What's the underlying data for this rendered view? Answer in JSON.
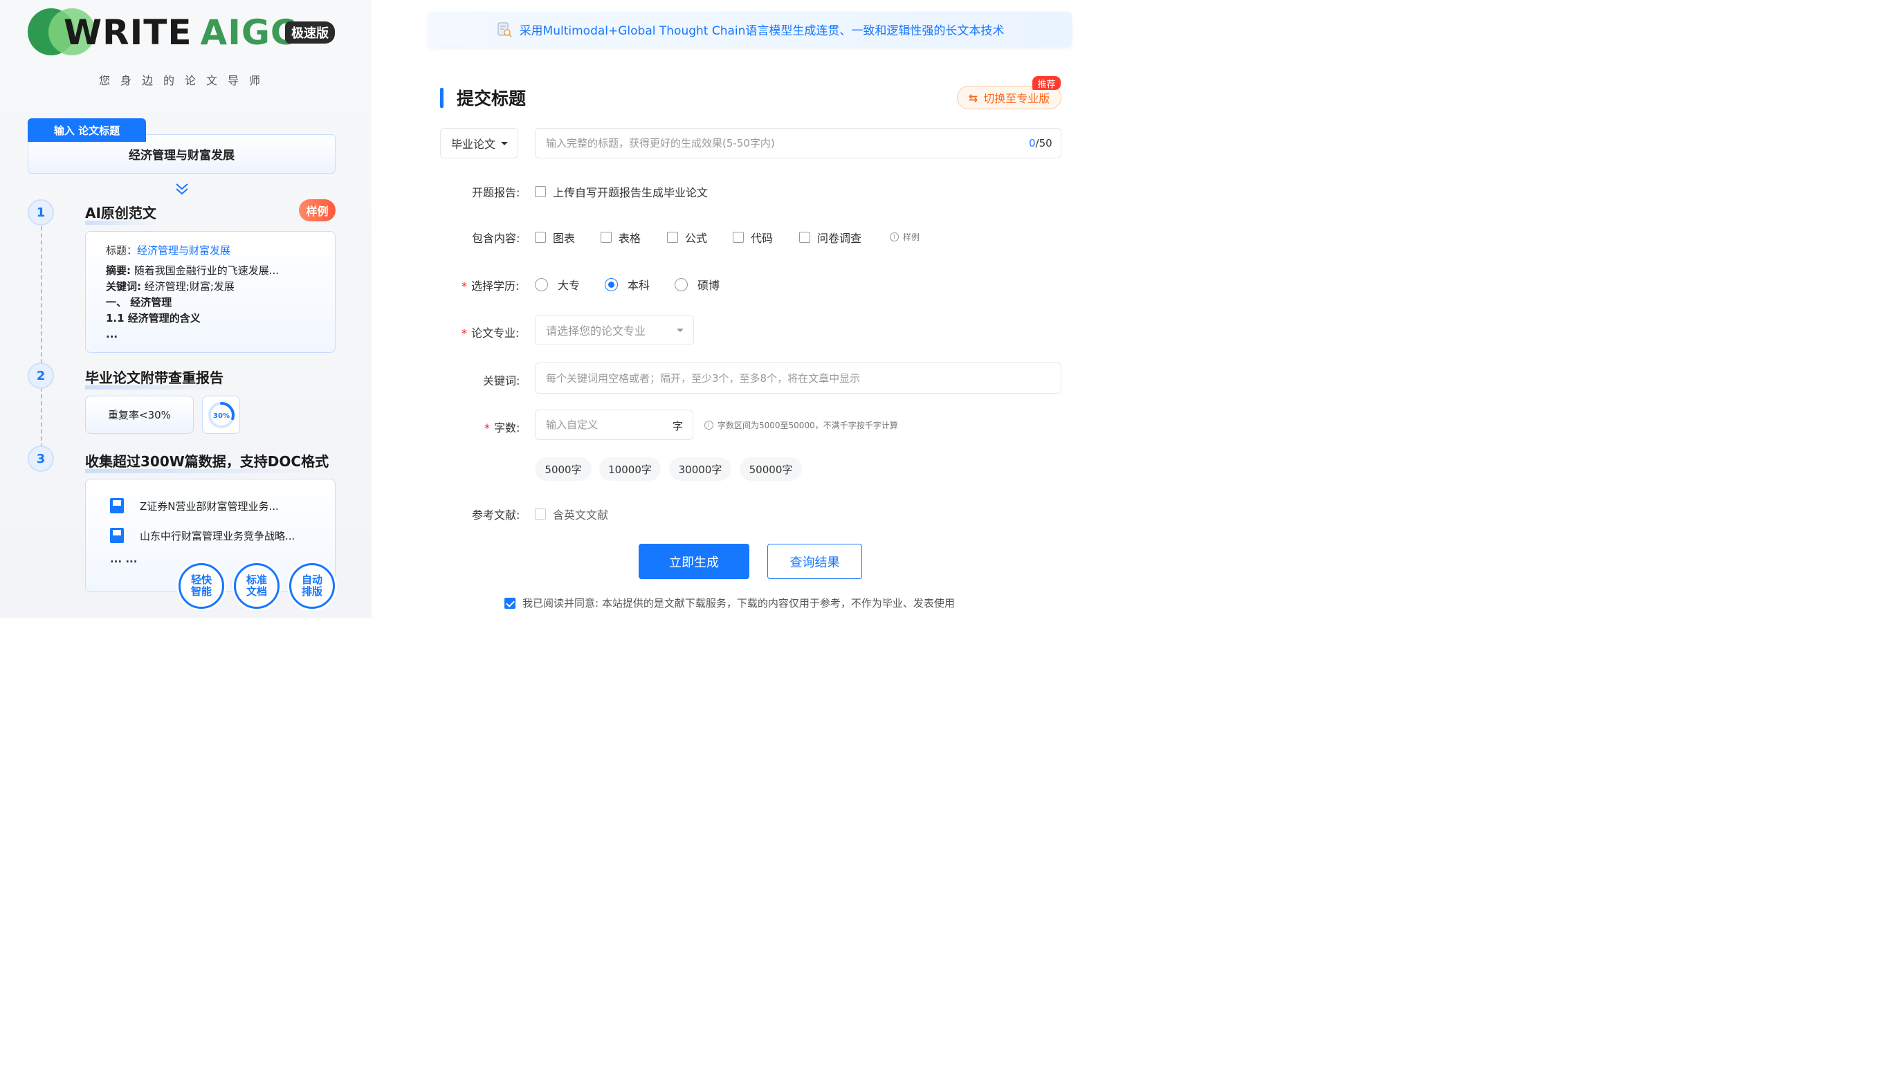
{
  "brand": {
    "logo_write": "WRITE",
    "logo_aigc": "AIGC",
    "logo_badge": "极速版",
    "tagline": "您身边的论文导师"
  },
  "left": {
    "input_tab": "输入 论文标题",
    "input_title": "经济管理与财富发展",
    "steps": [
      {
        "num": "1",
        "title": "AI原创范文"
      },
      {
        "num": "2",
        "title": "毕业论文附带查重报告"
      },
      {
        "num": "3",
        "title": "收集超过300W篇数据，支持DOC格式"
      }
    ],
    "sample_badge": "样例",
    "sample": {
      "title_label": "标题：",
      "title_value": "经济管理与财富发展",
      "abstract_label": "摘要:",
      "abstract_value": " 随着我国金融行业的飞速发展...",
      "keywords_label": "关键词:",
      "keywords_value": " 经济管理;财富;发展",
      "heading1": "一、 经济管理",
      "heading2": "1.1 经济管理的含义",
      "ellipsis": "..."
    },
    "rate_text": "重复率<30%",
    "gauge_text": "30%",
    "gauge_level": 0.3,
    "docs": [
      "Z证券N营业部财富管理业务...",
      "山东中行财富管理业务竞争战略..."
    ],
    "docs_ellipsis": "... ...",
    "features": [
      "轻快智能",
      "标准文档",
      "自动排版"
    ]
  },
  "right": {
    "banner": "采用Multimodal+Global Thought Chain语言模型生成连贯、一致和逻辑性强的长文本技术",
    "section_title": "提交标题",
    "pro_button": "切换至专业版",
    "recommend_badge": "推荐",
    "paper_type": "毕业论文",
    "title_placeholder": "输入完整的标题，获得更好的生成效果(5-50字内)",
    "counter_current": "0",
    "counter_max": "/50",
    "labels": {
      "proposal": "开题报告:",
      "content": "包含内容:",
      "degree": "选择学历:",
      "major": "论文专业:",
      "keywords": "关键词:",
      "words": "字数:",
      "refs": "参考文献:"
    },
    "proposal_option": "上传自写开题报告生成毕业论文",
    "content_options": [
      "图表",
      "表格",
      "公式",
      "代码",
      "问卷调查"
    ],
    "content_hint": "样例",
    "degree_options": [
      "大专",
      "本科",
      "硕博"
    ],
    "degree_selected": "本科",
    "major_placeholder": "请选择您的论文专业",
    "keywords_placeholder": "每个关键词用空格或者；隔开，至少3个，至多8个，将在文章中显示",
    "words_placeholder": "输入自定义",
    "words_unit": "字",
    "words_hint": "字数区间为5000至50000，不满千字按千字计算",
    "word_chips": [
      "5000字",
      "10000字",
      "30000字",
      "50000字"
    ],
    "refs_option": "含英文文献",
    "generate_button": "立即生成",
    "query_button": "查询结果",
    "agree_text": "我已阅读并同意: 本站提供的是文献下载服务，下载的内容仅用于参考，不作为毕业、发表使用"
  },
  "colors": {
    "accent": "#1677ff",
    "brand_green": "#3b9a55",
    "orange": "#ff6a1a",
    "required": "#f5222d"
  }
}
